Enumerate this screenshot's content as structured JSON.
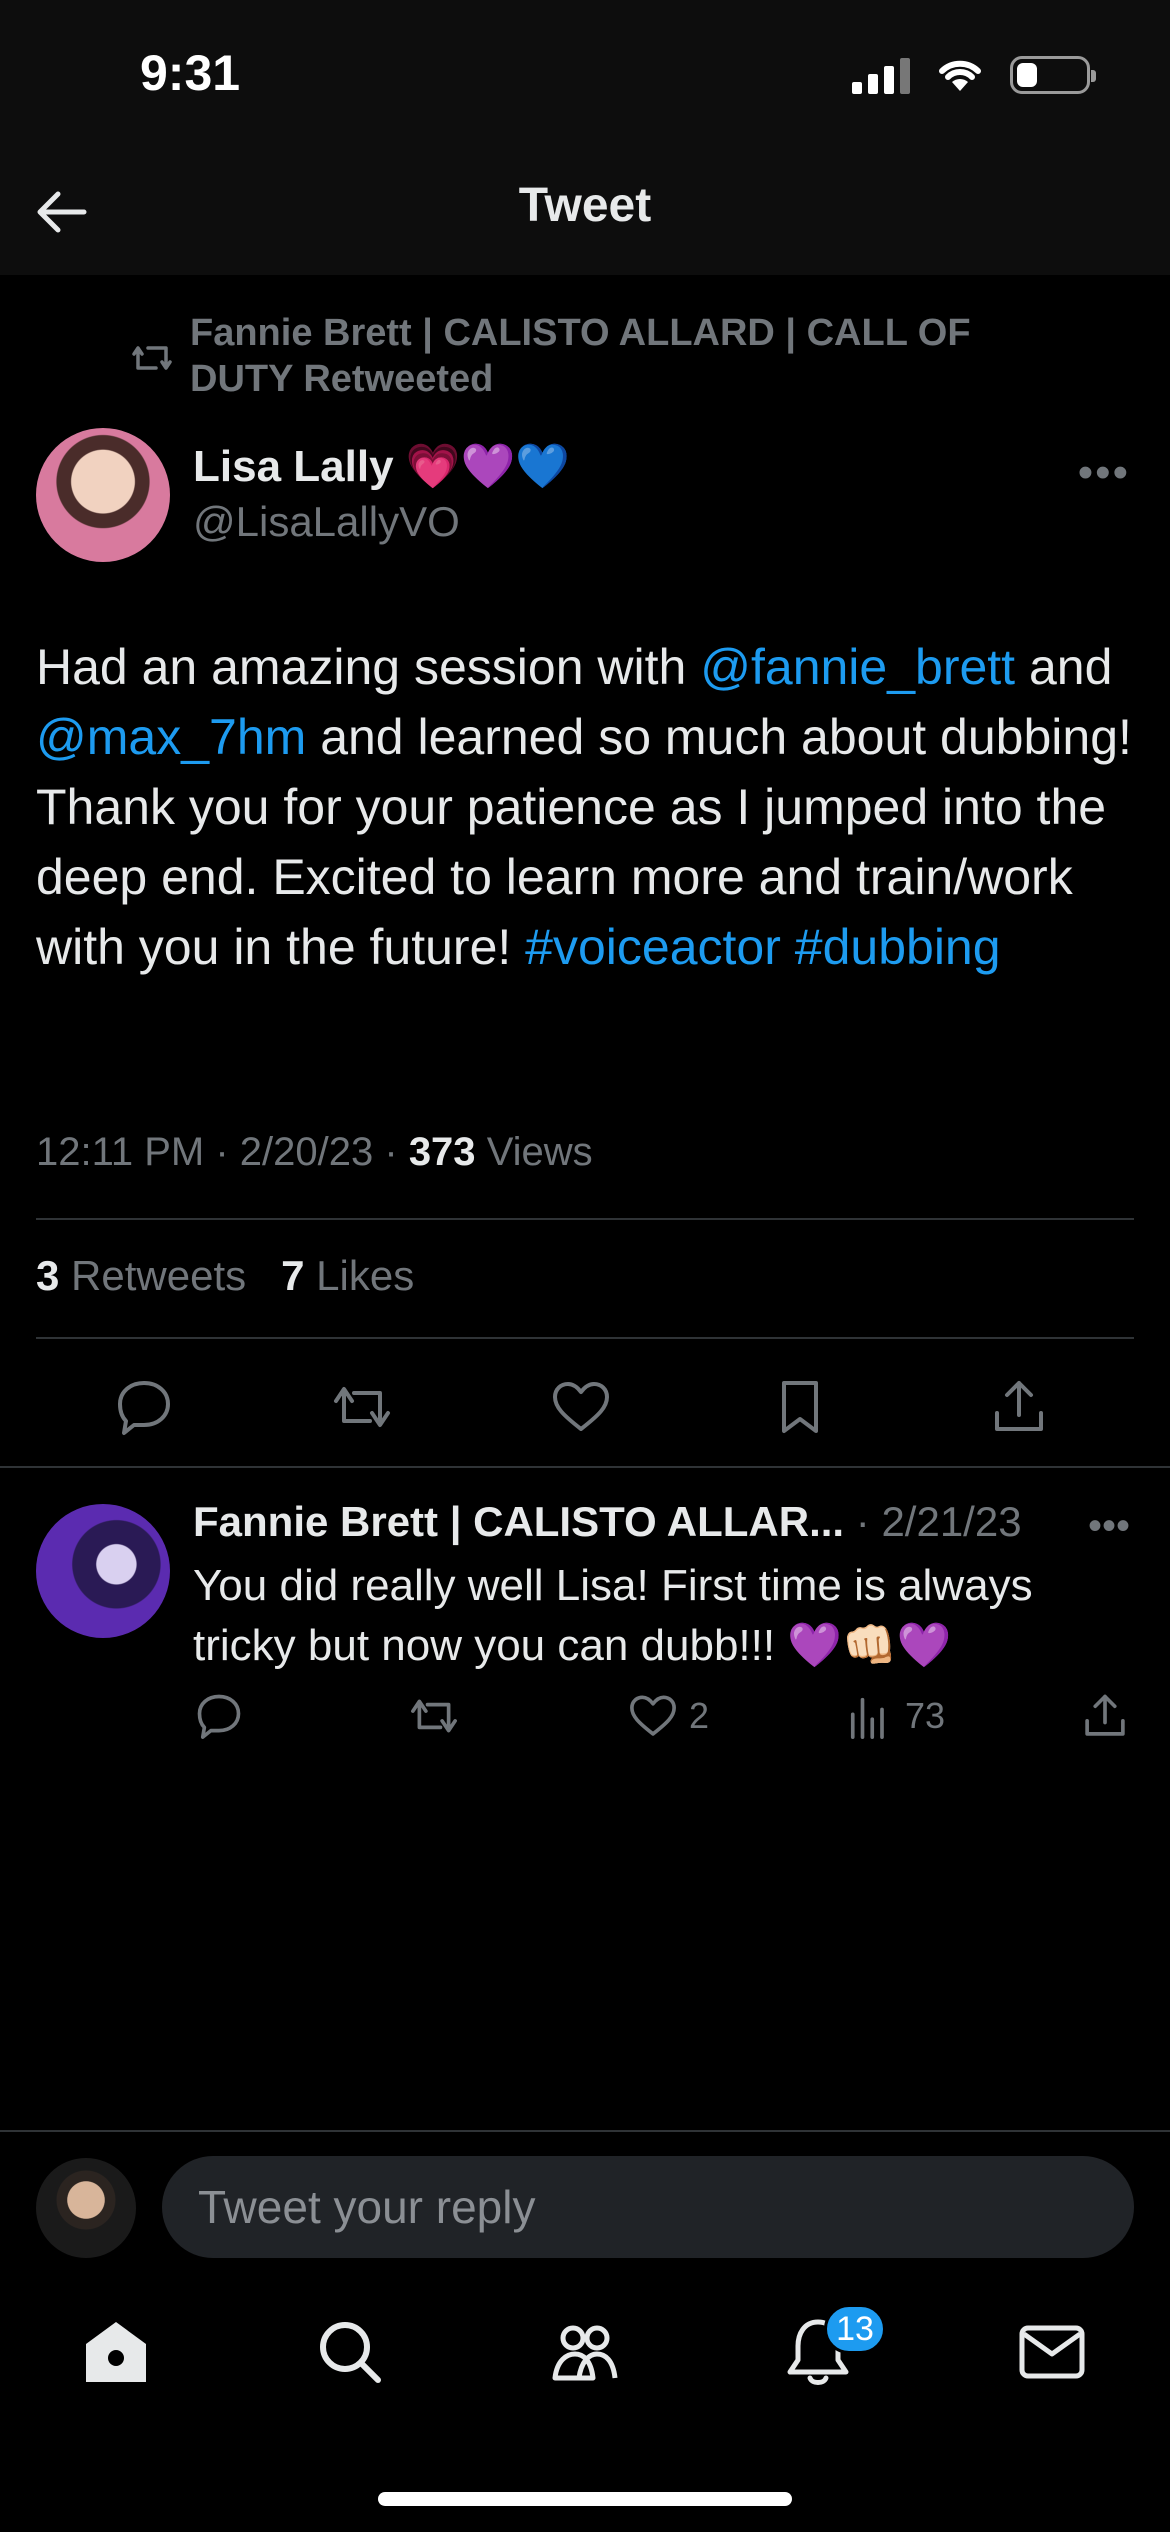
{
  "status": {
    "time": "9:31"
  },
  "header": {
    "title": "Tweet"
  },
  "retweet": {
    "text": "Fannie Brett | CALISTO ALLARD | CALL OF DUTY Retweeted"
  },
  "tweet": {
    "author_name": "Lisa Lally 💗💜💙",
    "author_handle": "@LisaLallyVO",
    "body": {
      "t1": "Had an amazing session with ",
      "m1": "@fannie_brett",
      "t2": " and ",
      "m2": "@max_7hm",
      "t3": " and learned so much about dubbing! Thank you for your patience as I jumped into the deep end. Excited to learn more and train/work with you in the future! ",
      "h1": "#voiceactor",
      "t4": " ",
      "h2": "#dubbing"
    },
    "time": "12:11 PM",
    "date": "2/20/23",
    "views_count": "373",
    "views_label": "Views",
    "retweets_count": "3",
    "retweets_label": "Retweets",
    "likes_count": "7",
    "likes_label": "Likes"
  },
  "reply": {
    "name": "Fannie Brett | CALISTO ALLAR...",
    "date": "2/21/23",
    "text": "You did really well Lisa! First time is always tricky but now you can dubb!!! 💜👊🏻💜",
    "likes": "2",
    "views": "73"
  },
  "composer": {
    "placeholder": "Tweet your reply"
  },
  "tabs": {
    "notifications_badge": "13"
  },
  "colors": {
    "accent": "#1d9bf0",
    "background": "#000000",
    "muted": "#71767b"
  }
}
